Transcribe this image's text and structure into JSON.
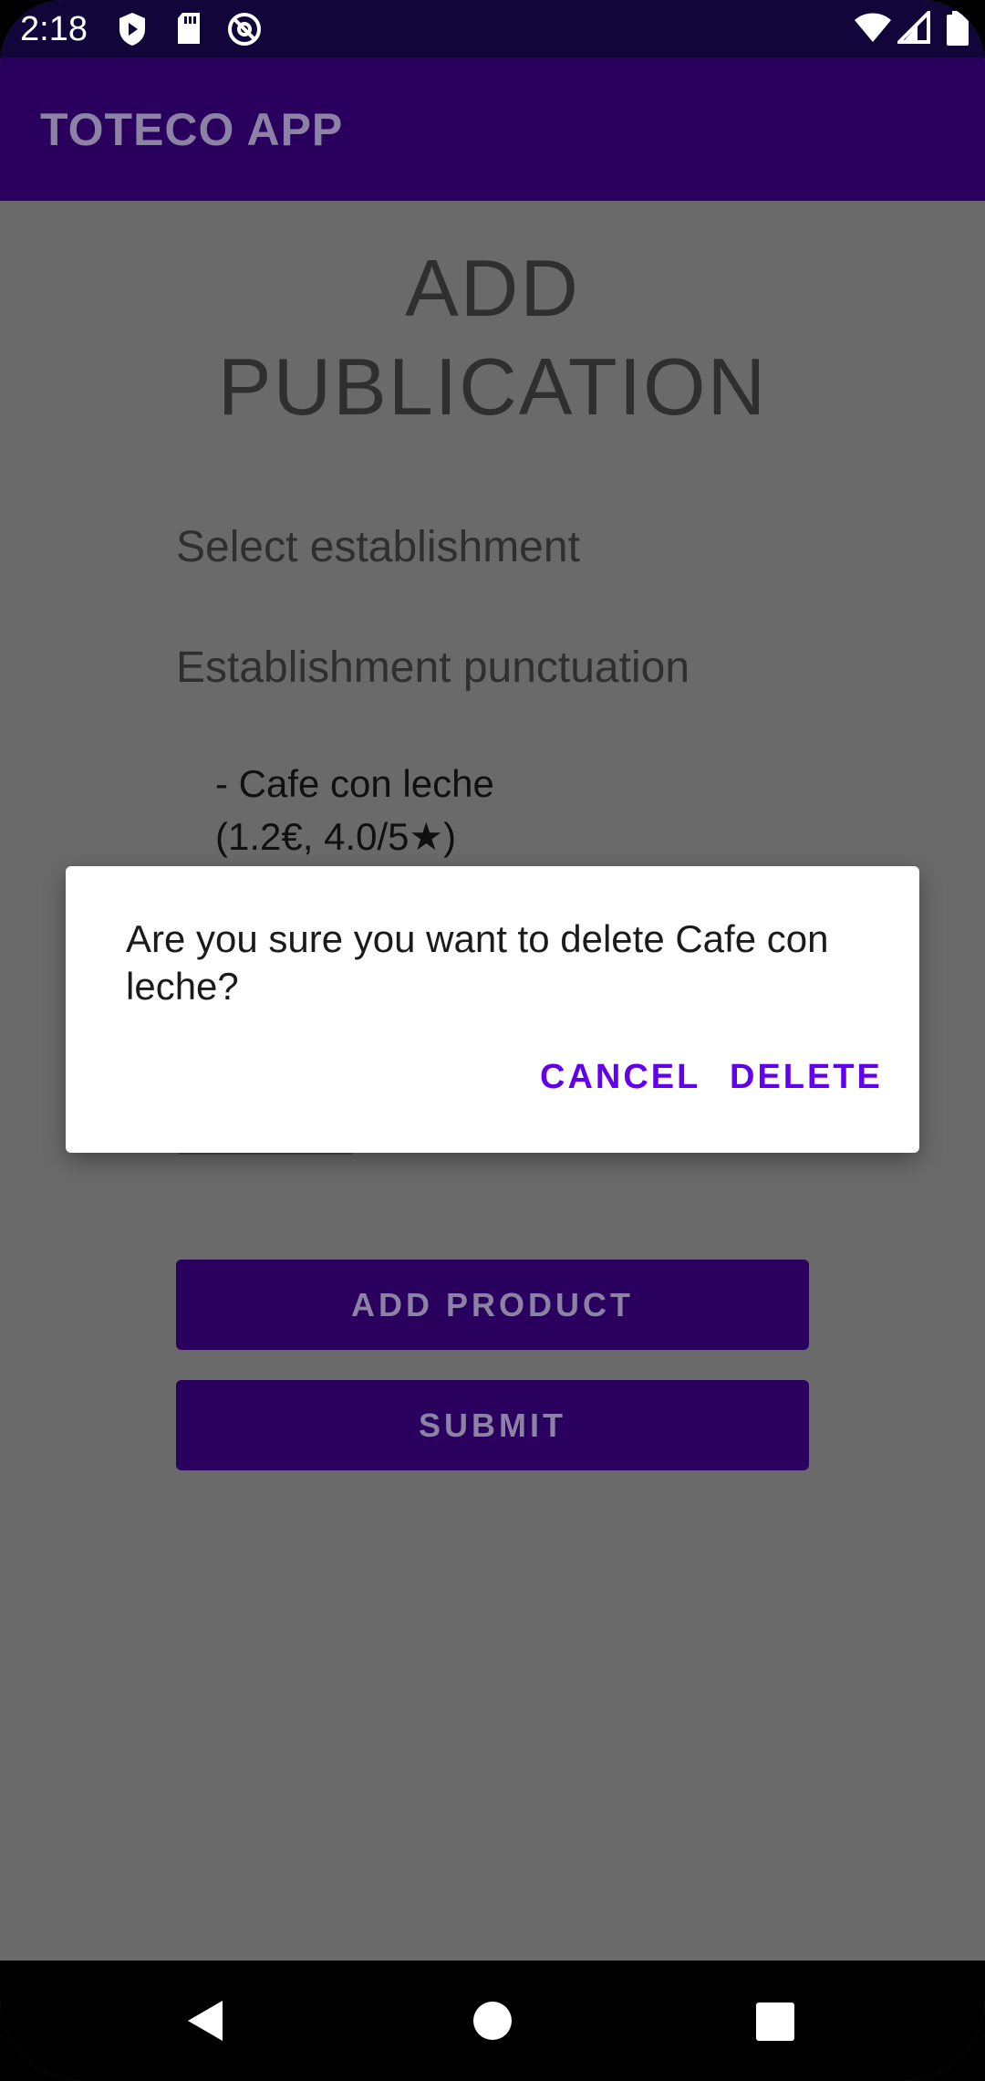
{
  "status_bar": {
    "time": "2:18",
    "left_icons": [
      "shield-play-icon",
      "sd-card-icon",
      "at-sign-icon"
    ],
    "right_icons": [
      "wifi-icon",
      "cell-signal-icon",
      "battery-icon"
    ]
  },
  "app_bar": {
    "title": "TOTECO APP"
  },
  "content": {
    "title_line1": "ADD",
    "title_line2": "PUBLICATION",
    "select_label": "Select establishment",
    "punctuation_label": "Establishment punctuation",
    "product_line1": "- Cafe con leche",
    "product_line2": "(1.2€, 4.0/5★)",
    "add_product_label": "ADD PRODUCT",
    "submit_label": "SUBMIT"
  },
  "dialog": {
    "message": "Are you sure you want to delete Cafe con leche?",
    "cancel_label": "CANCEL",
    "delete_label": "DELETE"
  },
  "nav_bar": {
    "icons": [
      "back-icon",
      "home-icon",
      "recents-icon"
    ]
  },
  "colors": {
    "accent": "#6200ee",
    "app_bar": "#2a005f",
    "status_bar": "#11053a",
    "scrim_background": "#6a6a6a"
  }
}
